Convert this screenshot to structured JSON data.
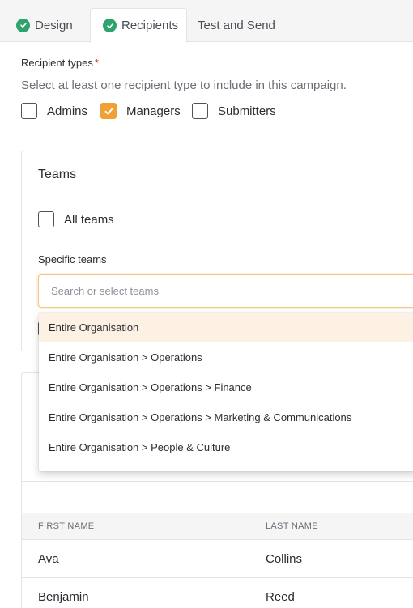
{
  "tabs": [
    {
      "label": "Design",
      "completed": true
    },
    {
      "label": "Recipients",
      "completed": true,
      "active": true
    },
    {
      "label": "Test and Send",
      "completed": false
    }
  ],
  "recipient_types": {
    "label": "Recipient types",
    "required_marker": "*",
    "help_text": "Select at least one recipient type to include in this campaign.",
    "options": [
      {
        "label": "Admins",
        "checked": false
      },
      {
        "label": "Managers",
        "checked": true
      },
      {
        "label": "Submitters",
        "checked": false
      }
    ]
  },
  "teams": {
    "title": "Teams",
    "all_teams_label": "All teams",
    "all_teams_checked": false,
    "specific_label": "Specific teams",
    "search_placeholder": "Search or select teams",
    "dropdown_options": [
      "Entire Organisation",
      "Entire Organisation > Operations",
      "Entire Organisation > Operations > Finance",
      "Entire Organisation > Operations > Marketing & Communications",
      "Entire Organisation > People & Culture"
    ]
  },
  "table": {
    "columns": [
      "FIRST NAME",
      "LAST NAME"
    ],
    "rows": [
      {
        "first": "Ava",
        "last": "Collins"
      },
      {
        "first": "Benjamin",
        "last": "Reed"
      }
    ]
  },
  "colors": {
    "accent": "#f0a034",
    "success": "#2ea36b",
    "highlight": "#fdf1e3"
  }
}
